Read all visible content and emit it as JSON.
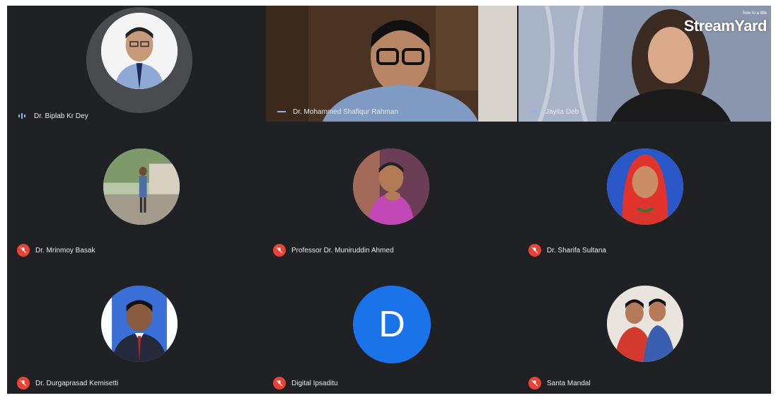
{
  "watermark": {
    "caption": "how to a title",
    "brand": "StreamYard"
  },
  "colors": {
    "background": "#202124",
    "mic_off": "#ea4335",
    "initial_avatar": "#1a73e8"
  },
  "participants": [
    {
      "name": "Dr. Biplab Kr Dey",
      "mic": "active",
      "view": "avatar"
    },
    {
      "name": "Dr. Mohammed Shafiqur Rahman",
      "mic": "active",
      "view": "video"
    },
    {
      "name": "Jayita Deb",
      "mic": "active",
      "view": "video"
    },
    {
      "name": "Dr. Mrinmoy Basak",
      "mic": "muted",
      "view": "avatar"
    },
    {
      "name": "Professor Dr. Muniruddin Ahmed",
      "mic": "muted",
      "view": "avatar"
    },
    {
      "name": "Dr. Sharifa Sultana",
      "mic": "muted",
      "view": "avatar"
    },
    {
      "name": "Dr. Durgaprasad Kemisetti",
      "mic": "muted",
      "view": "avatar"
    },
    {
      "name": "Digital Ipsaditu",
      "mic": "muted",
      "view": "initial",
      "initial": "D"
    },
    {
      "name": "Santa Mandal",
      "mic": "muted",
      "view": "avatar"
    }
  ]
}
